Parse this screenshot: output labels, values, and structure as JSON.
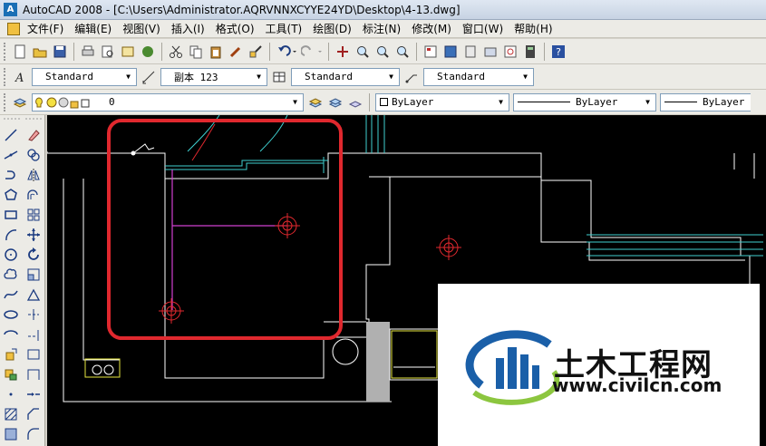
{
  "window": {
    "title": "AutoCAD 2008 - [C:\\Users\\Administrator.AQRVNNXCYYE24YD\\Desktop\\4-13.dwg]",
    "app_icon_letter": "A"
  },
  "menu": {
    "items": [
      "文件(F)",
      "编辑(E)",
      "视图(V)",
      "插入(I)",
      "格式(O)",
      "工具(T)",
      "绘图(D)",
      "标注(N)",
      "修改(M)",
      "窗口(W)",
      "帮助(H)"
    ]
  },
  "styles_toolbar": {
    "text_style": "Standard",
    "dim_style": "副本 123",
    "table_style": "Standard",
    "multileader_style": "Standard"
  },
  "layers_toolbar": {
    "layer_name": "0",
    "color": "ByLayer",
    "linetype": "ByLayer",
    "lineweight": "ByLayer"
  },
  "watermark": {
    "title": "土木工程网",
    "url": "www.civilcn.com"
  },
  "colors": {
    "canvas_bg": "#000000",
    "highlight_red": "#e0282e",
    "cyan_lines": "#3fd0d0",
    "magenta_lines": "#d040d0",
    "yellow_lines": "#e8e840",
    "logo_blue": "#1a5fa8",
    "logo_green": "#8cc63f"
  }
}
